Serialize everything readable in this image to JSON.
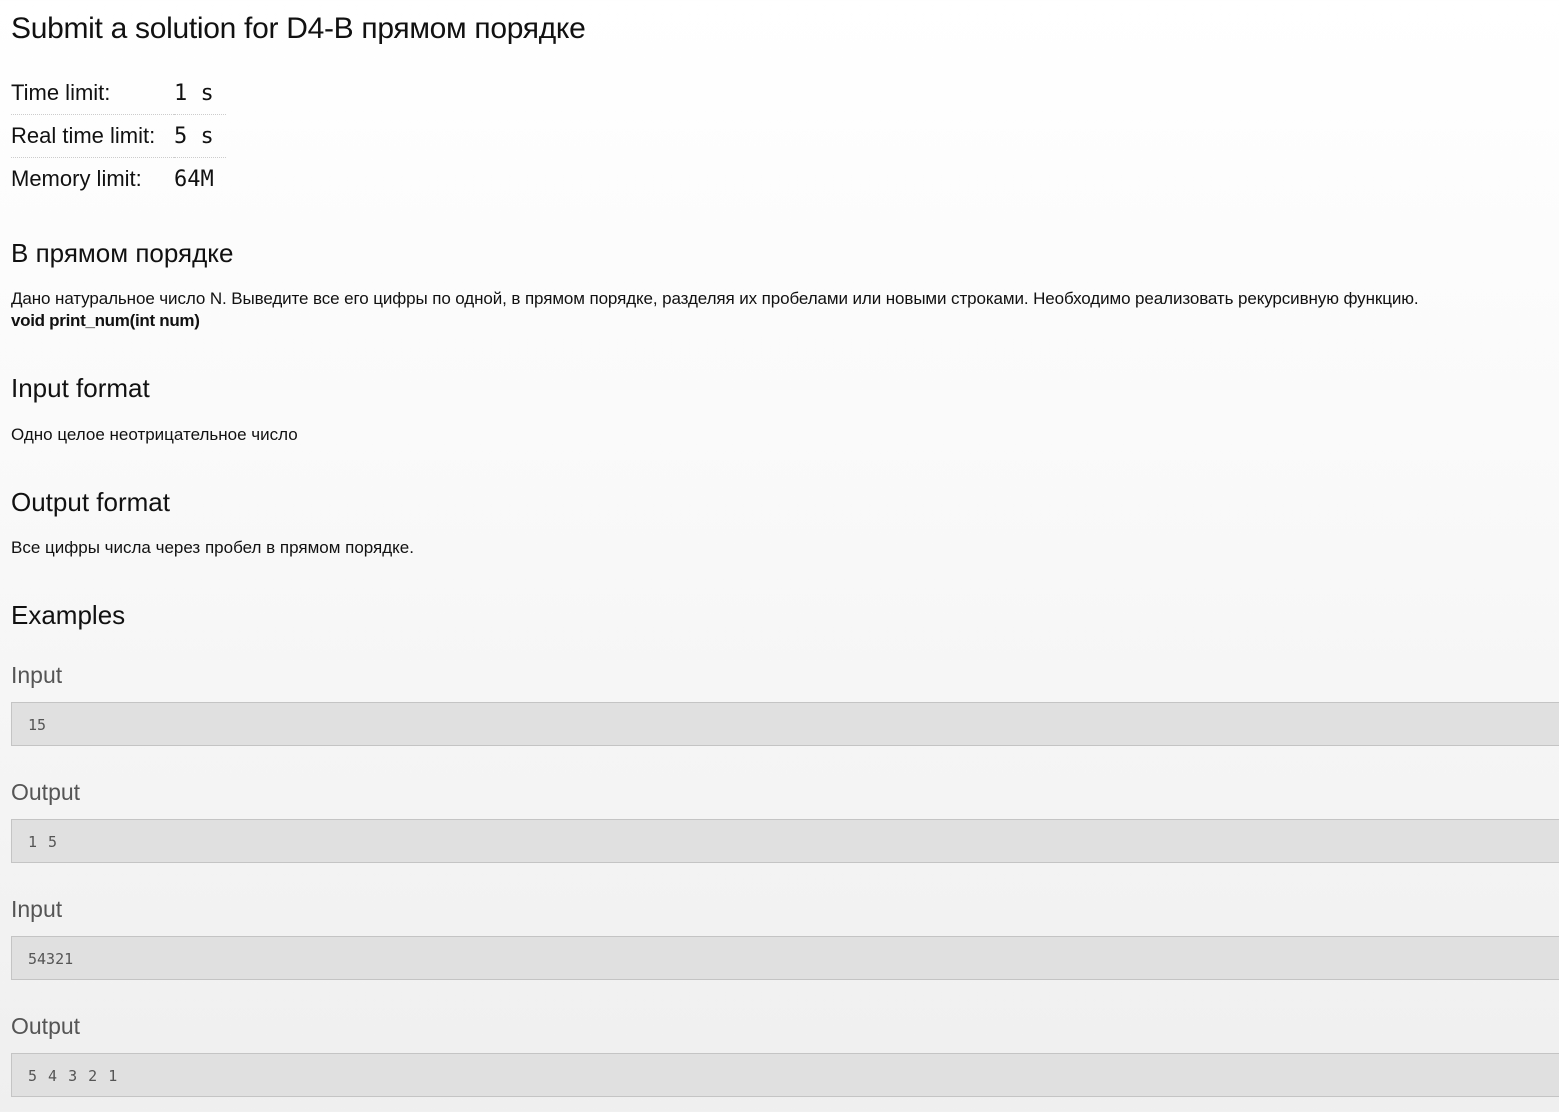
{
  "title": "Submit a solution for D4-B прямом порядке",
  "limits": [
    {
      "label": "Time limit:",
      "value": "1 s"
    },
    {
      "label": "Real time limit:",
      "value": "5 s"
    },
    {
      "label": "Memory limit:",
      "value": "64M"
    }
  ],
  "problem": {
    "name": "В прямом порядке",
    "statement": "Дано натуральное число N. Выведите все его цифры по одной, в прямом порядке, разделяя их пробелами или новыми строками. Необходимо реализовать рекурсивную функцию.",
    "signature": "void print_num(int num)",
    "input_heading": "Input format",
    "input_text": "Одно целое неотрицательное число",
    "output_heading": "Output format",
    "output_text": "Все цифры числа через пробел в прямом порядке."
  },
  "examples": {
    "heading": "Examples",
    "items": [
      {
        "label": "Input",
        "value": "15"
      },
      {
        "label": "Output",
        "value": "1 5"
      },
      {
        "label": "Input",
        "value": "54321"
      },
      {
        "label": "Output",
        "value": "5 4 3 2 1"
      }
    ]
  }
}
